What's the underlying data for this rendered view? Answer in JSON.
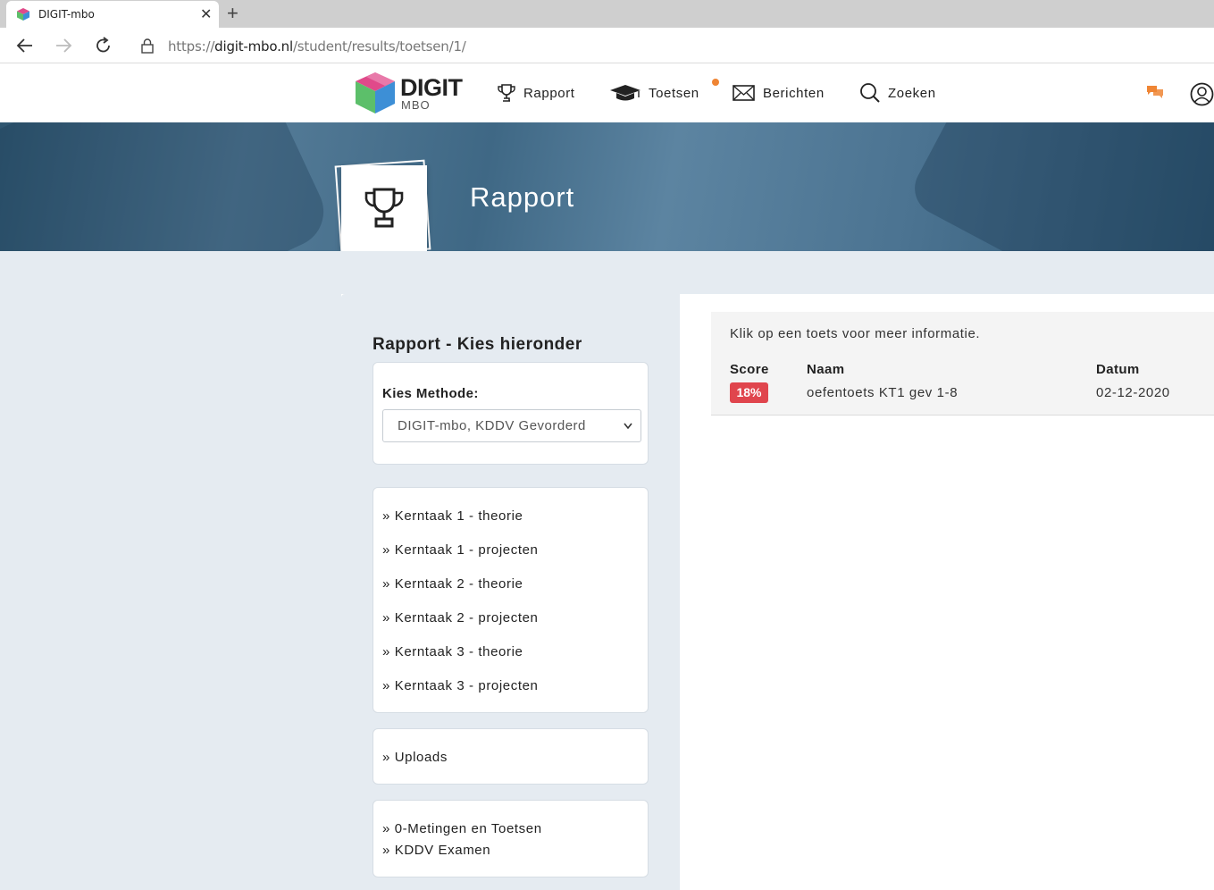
{
  "browser": {
    "tab_title": "DIGIT-mbo",
    "url_scheme": "https://",
    "url_host": "digit-mbo.nl",
    "url_path": "/student/results/toetsen/1/"
  },
  "header": {
    "logo_text": "DIGIT",
    "logo_sub": "MBO",
    "nav": {
      "rapport": "Rapport",
      "toetsen": "Toetsen",
      "berichten": "Berichten",
      "zoeken": "Zoeken"
    },
    "accent_color": "#ef8534"
  },
  "banner": {
    "title": "Rapport"
  },
  "sidebar": {
    "title": "Rapport - Kies hieronder",
    "methode_label": "Kies Methode:",
    "methode_selected": "DIGIT-mbo, KDDV Gevorderd",
    "kerntaken": [
      "» Kerntaak 1 - theorie",
      "» Kerntaak 1 - projecten",
      "» Kerntaak 2 - theorie",
      "» Kerntaak 2 - projecten",
      "» Kerntaak 3 - theorie",
      "» Kerntaak 3 - projecten"
    ],
    "uploads": "» Uploads",
    "metingen": "» 0-Metingen en Toetsen",
    "examen": "» KDDV Examen"
  },
  "results": {
    "info": "Klik op een toets voor meer informatie.",
    "headers": {
      "score": "Score",
      "naam": "Naam",
      "datum": "Datum"
    },
    "rows": [
      {
        "score": "18%",
        "naam": "oefentoets KT1 gev 1-8",
        "datum": "02-12-2020",
        "score_color": "#e0454d"
      }
    ]
  }
}
